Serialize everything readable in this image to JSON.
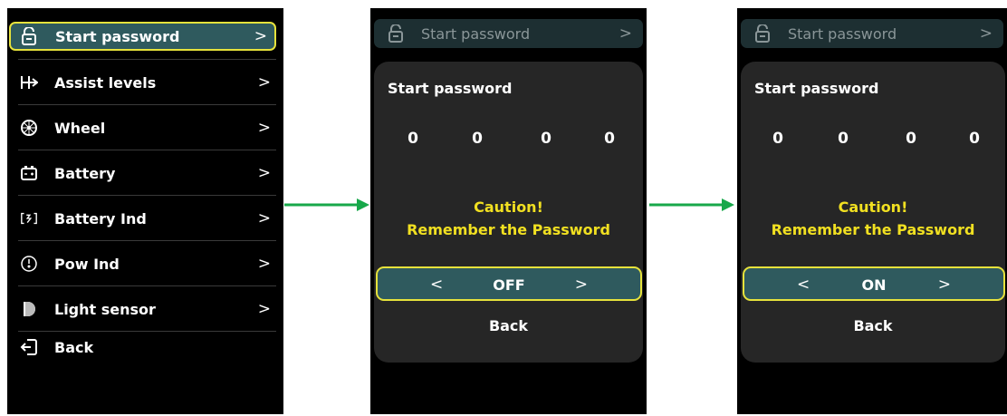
{
  "menu_screen": {
    "items": [
      {
        "label": "Start password",
        "icon": "lock-icon"
      },
      {
        "label": "Assist levels",
        "icon": "assist-levels-icon"
      },
      {
        "label": "Wheel",
        "icon": "wheel-icon"
      },
      {
        "label": "Battery",
        "icon": "battery-icon"
      },
      {
        "label": "Battery Ind",
        "icon": "battery-ind-icon"
      },
      {
        "label": "Pow Ind",
        "icon": "power-ind-icon"
      },
      {
        "label": "Light sensor",
        "icon": "light-sensor-icon"
      }
    ],
    "back_label": "Back",
    "chevron": ">"
  },
  "password_dialog_off": {
    "header": "Start password",
    "title": "Start password",
    "digits": [
      "0",
      "0",
      "0",
      "0"
    ],
    "caution_line1": "Caution!",
    "caution_line2": "Remember the Password",
    "toggle_left": "<",
    "toggle_value": "OFF",
    "toggle_right": ">",
    "back_label": "Back",
    "chevron": ">"
  },
  "password_dialog_on": {
    "header": "Start password",
    "title": "Start password",
    "digits": [
      "0",
      "0",
      "0",
      "0"
    ],
    "caution_line1": "Caution!",
    "caution_line2": "Remember the Password",
    "toggle_left": "<",
    "toggle_value": "ON",
    "toggle_right": ">",
    "back_label": "Back",
    "chevron": ">"
  },
  "colors": {
    "highlight_bg": "#2f5a5e",
    "highlight_border": "#e6e23c",
    "caution_text": "#f1e021",
    "panel_bg": "#262626",
    "arrow": "#17a84a"
  }
}
